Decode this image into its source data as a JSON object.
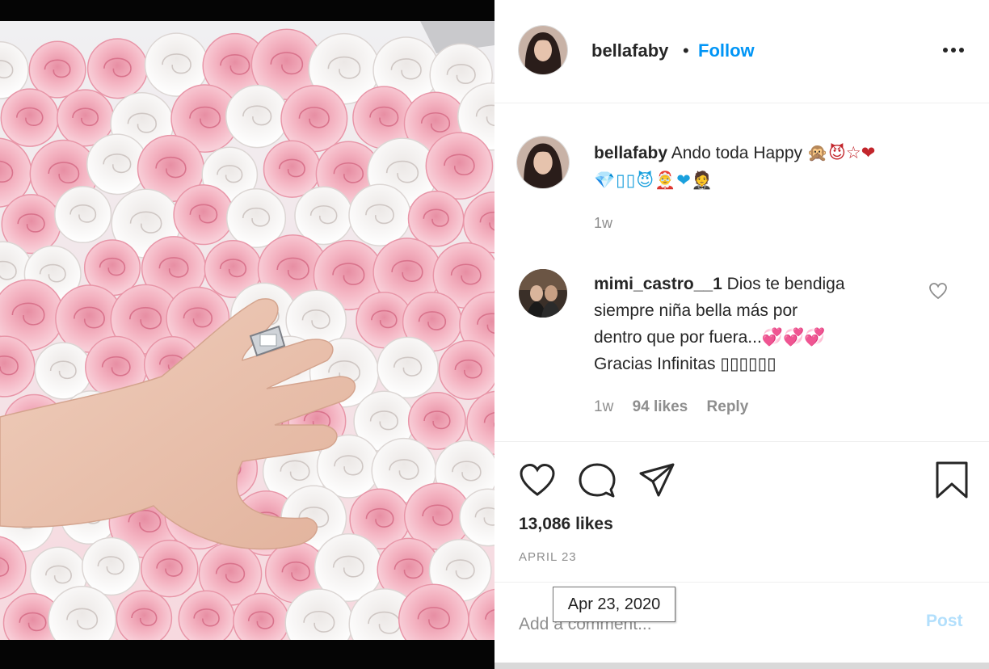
{
  "post": {
    "username": "bellafaby",
    "separator": "•",
    "follow_label": "Follow",
    "more_icon": "more-horizontal-icon"
  },
  "caption": {
    "username": "bellafaby",
    "text": "Ando toda Happy",
    "emojis_line1": "🙊😈☆❤",
    "emojis_line2": "💎▯▯😈🤶❤🤵",
    "time": "1w"
  },
  "comment": {
    "username": "mimi_castro__1",
    "text_line1": "Dios te bendiga",
    "text_line2": "siempre niña bella más por",
    "text_line3": "dentro que por fuera...",
    "hearts": "💞💞💞",
    "text_line4": "Gracias Infinitas ▯▯▯▯▯▯",
    "time": "1w",
    "likes": "94 likes",
    "reply_label": "Reply"
  },
  "actions": {
    "icons": [
      "heart-icon",
      "comment-bubble-icon",
      "share-plane-icon",
      "bookmark-icon"
    ],
    "likes_count": "13,086 likes",
    "date": "APRIL 23"
  },
  "add_comment": {
    "placeholder": "Add a comment...",
    "post_label": "Post"
  },
  "tooltip": {
    "text": "Apr 23, 2020"
  },
  "colors": {
    "link_blue": "#0095f6",
    "post_disabled": "#b2dffc",
    "secondary_text": "#8e8e8e"
  }
}
